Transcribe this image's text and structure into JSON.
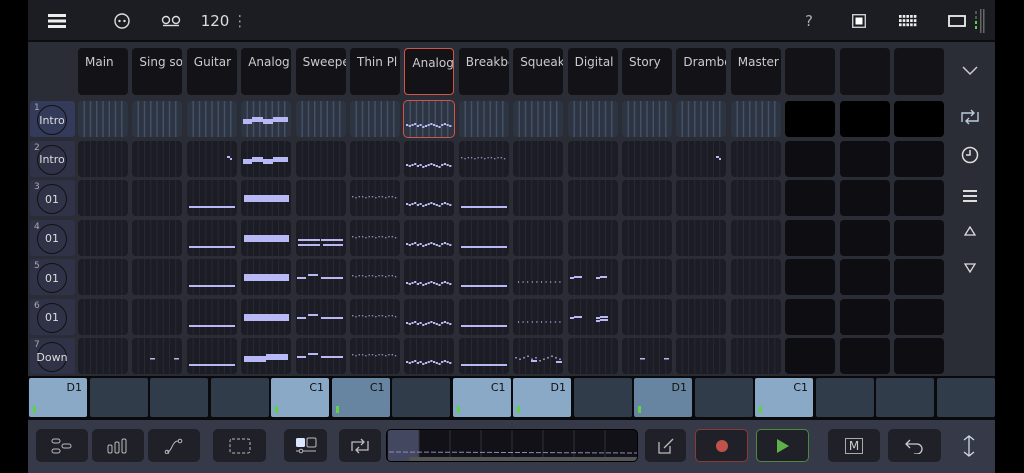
{
  "topbar": {
    "menu_icon": "hamburger-icon",
    "face_icon": "smiley-icon",
    "tape_icon": "tape-icon",
    "tempo": "120",
    "tempo_more": "⋮",
    "help": "?",
    "icons": [
      "stop-square-icon",
      "grid-icon",
      "window-icon",
      "level-meter-icon"
    ]
  },
  "tracks": [
    "Main",
    "Sing so",
    "Guitar",
    "Analog",
    "Sweepe",
    "Thin Pl",
    "Analog",
    "Breakbe",
    "Squeak",
    "Digital I",
    "Story",
    "Drambo",
    "Master",
    "",
    "",
    ""
  ],
  "selected_track": 6,
  "scenes": [
    {
      "num": "1",
      "name": "Intro"
    },
    {
      "num": "2",
      "name": "Intro"
    },
    {
      "num": "3",
      "name": "01"
    },
    {
      "num": "4",
      "name": "01"
    },
    {
      "num": "5",
      "name": "01"
    },
    {
      "num": "6",
      "name": "01"
    },
    {
      "num": "7",
      "name": "Down"
    }
  ],
  "clips": [
    [
      "e",
      "e",
      "e",
      "wave",
      "e",
      "e",
      "melody",
      "e",
      "e",
      "e",
      "e",
      "e",
      "e",
      "x",
      "x",
      "x"
    ],
    [
      "e",
      "e",
      "tick",
      "wave",
      "e",
      "e",
      "melody",
      "dots",
      "e",
      "e",
      "e",
      "tick",
      "e",
      "",
      "",
      ""
    ],
    [
      "e",
      "e",
      "line",
      "block",
      "e",
      "dots",
      "melody",
      "line",
      "e",
      "e",
      "e",
      "e",
      "e",
      "",
      "",
      ""
    ],
    [
      "e",
      "e",
      "line",
      "block",
      "dline",
      "dots",
      "melody",
      "line",
      "e",
      "e",
      "e",
      "e",
      "e",
      "",
      "",
      ""
    ],
    [
      "e",
      "e",
      "line",
      "block",
      "curve",
      "dots",
      "melody",
      "line",
      "sdots",
      "bars",
      "e",
      "e",
      "e",
      "",
      "",
      ""
    ],
    [
      "e",
      "e",
      "line",
      "block",
      "curve",
      "dots",
      "melody",
      "line",
      "sdots",
      "bars2",
      "e",
      "e",
      "e",
      "",
      "",
      ""
    ],
    [
      "e",
      "dash",
      "line",
      "block2",
      "curve",
      "dots",
      "melody",
      "line",
      "smel",
      "e",
      "dash",
      "e",
      "e",
      "",
      "",
      ""
    ]
  ],
  "selected_clip": {
    "row": 0,
    "col": 6
  },
  "sidebar": [
    "chevron-down-icon",
    "loop-icon",
    "clock-icon",
    "list-icon",
    "triangle-up-icon",
    "triangle-down-icon"
  ],
  "strip": [
    {
      "label": "D1",
      "tone": "light"
    },
    {
      "label": "",
      "tone": ""
    },
    {
      "label": "",
      "tone": ""
    },
    {
      "label": "",
      "tone": ""
    },
    {
      "label": "C1",
      "tone": "light"
    },
    {
      "label": "C1",
      "tone": "mid"
    },
    {
      "label": "",
      "tone": ""
    },
    {
      "label": "C1",
      "tone": "light"
    },
    {
      "label": "D1",
      "tone": "light"
    },
    {
      "label": "",
      "tone": ""
    },
    {
      "label": "D1",
      "tone": "mid"
    },
    {
      "label": "",
      "tone": ""
    },
    {
      "label": "C1",
      "tone": "light"
    },
    {
      "label": "",
      "tone": ""
    },
    {
      "label": "",
      "tone": ""
    },
    {
      "label": "",
      "tone": ""
    }
  ],
  "bottom": {
    "record_color": "#c0524a",
    "play_color": "#5fb24a",
    "m_label": "M"
  },
  "colors": {
    "note": "#b8b8f5",
    "select": "#d05548",
    "led": "#5fd04a"
  }
}
